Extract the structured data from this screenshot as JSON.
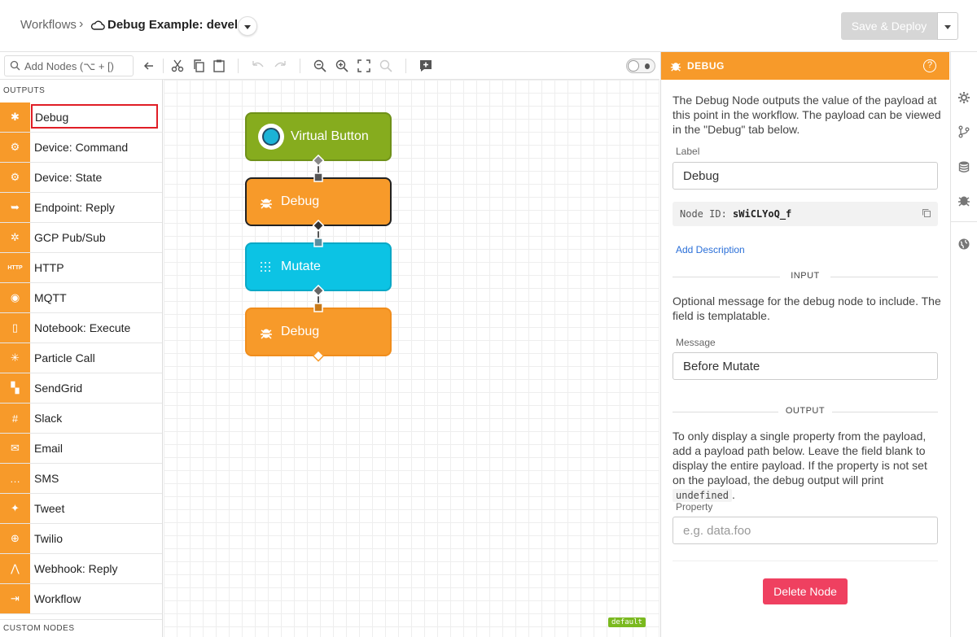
{
  "header": {
    "breadcrumb_root": "Workflows",
    "breadcrumb_sep": "›",
    "title": "Debug Example: develop",
    "save_label": "Save & Deploy"
  },
  "toolbar": {
    "search_placeholder": "Add Nodes (⌥ + [)"
  },
  "palette": {
    "section_outputs": "OUTPUTS",
    "section_custom": "CUSTOM NODES",
    "items": [
      {
        "label": "Debug",
        "icon": "bug-icon",
        "glyph": "✱"
      },
      {
        "label": "Device: Command",
        "icon": "gear-chip-icon",
        "glyph": "⚙"
      },
      {
        "label": "Device: State",
        "icon": "gear-chip-icon",
        "glyph": "⚙"
      },
      {
        "label": "Endpoint: Reply",
        "icon": "reply-icon",
        "glyph": "➥"
      },
      {
        "label": "GCP Pub/Sub",
        "icon": "gcp-icon",
        "glyph": "✲"
      },
      {
        "label": "HTTP",
        "icon": "http-icon",
        "glyph": "HTTP"
      },
      {
        "label": "MQTT",
        "icon": "rss-icon",
        "glyph": "◉"
      },
      {
        "label": "Notebook: Execute",
        "icon": "notebook-icon",
        "glyph": "▯"
      },
      {
        "label": "Particle Call",
        "icon": "particle-icon",
        "glyph": "✳"
      },
      {
        "label": "SendGrid",
        "icon": "sendgrid-icon",
        "glyph": "▚"
      },
      {
        "label": "Slack",
        "icon": "slack-icon",
        "glyph": "#"
      },
      {
        "label": "Email",
        "icon": "envelope-icon",
        "glyph": "✉"
      },
      {
        "label": "SMS",
        "icon": "chat-icon",
        "glyph": "…"
      },
      {
        "label": "Tweet",
        "icon": "twitter-icon",
        "glyph": "✦"
      },
      {
        "label": "Twilio",
        "icon": "twilio-icon",
        "glyph": "⊕"
      },
      {
        "label": "Webhook: Reply",
        "icon": "webhook-icon",
        "glyph": "⋀"
      },
      {
        "label": "Workflow",
        "icon": "workflow-icon",
        "glyph": "⇥"
      }
    ]
  },
  "canvas": {
    "nodes": [
      {
        "label": "Virtual Button",
        "type": "virtual-button",
        "color": "#86ac1e"
      },
      {
        "label": "Debug",
        "type": "debug",
        "color": "#f79a2a"
      },
      {
        "label": "Mutate",
        "type": "mutate",
        "color": "#0cc3e4"
      },
      {
        "label": "Debug",
        "type": "debug",
        "color": "#f79a2a"
      }
    ],
    "tag": "default"
  },
  "panel": {
    "header": "DEBUG",
    "description": "The Debug Node outputs the value of the payload at this point in the workflow. The payload can be viewed in the \"Debug\" tab below.",
    "label_label": "Label",
    "label_value": "Debug",
    "node_id_prefix": "Node ID:",
    "node_id": "sWiCLYoQ_f",
    "add_description": "Add Description",
    "input_heading": "INPUT",
    "input_description": "Optional message for the debug node to include. The field is templatable.",
    "message_label": "Message",
    "message_value": "Before Mutate",
    "output_heading": "OUTPUT",
    "output_desc_a": "To only display a single property from the payload, add a payload path below. Leave the field blank to display the entire payload. If the property is not set on the payload, the debug output will print",
    "output_desc_code": "undefined",
    "output_desc_end": ".",
    "property_label": "Property",
    "property_placeholder": "e.g. data.foo",
    "delete_label": "Delete Node"
  },
  "colors": {
    "accent_orange": "#f79a2a",
    "delete_red": "#ef4060",
    "selection_red": "#e01e26",
    "trigger_green": "#86ac1e",
    "mutate_cyan": "#0cc3e4"
  }
}
